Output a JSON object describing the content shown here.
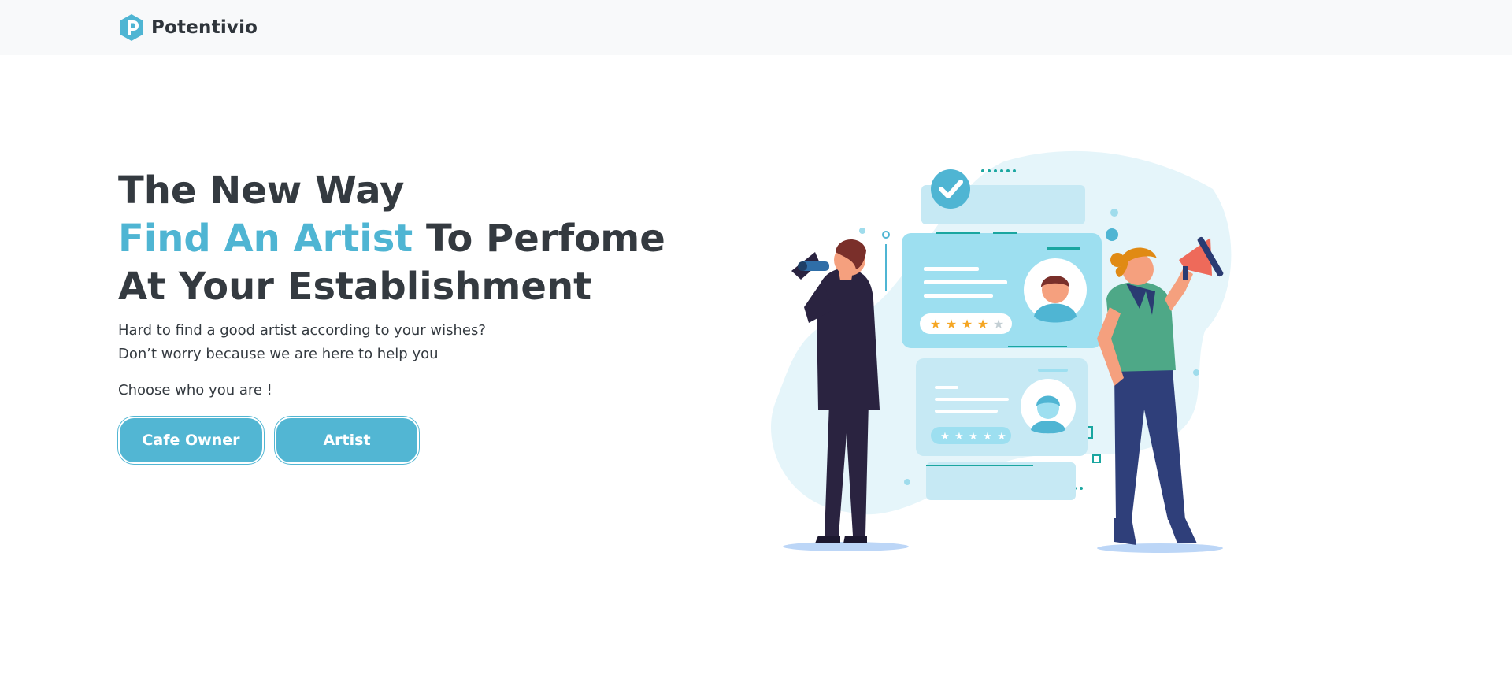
{
  "brand": {
    "name": "Potentivio"
  },
  "hero": {
    "headline_line1": "The New Way",
    "headline_accent": "Find An Artist",
    "headline_line2_rest": " To Perfome",
    "headline_line3": "At Your Establishment",
    "subtext_line1": "Hard to find a good artist according to your wishes?",
    "subtext_line2": "Don’t worry because we are here to help you",
    "choose_prompt": "Choose who you are !",
    "buttons": {
      "cafe_owner": "Cafe Owner",
      "artist": "Artist"
    }
  },
  "colors": {
    "accent": "#4fb5d3",
    "button": "#52b6d3",
    "text": "#343a40",
    "navbar_bg": "#f8f9fa"
  },
  "illustration": {
    "description_icon": "people-finding-artist-illustration",
    "top_card_rating": 4,
    "bottom_card_rating": 5
  }
}
